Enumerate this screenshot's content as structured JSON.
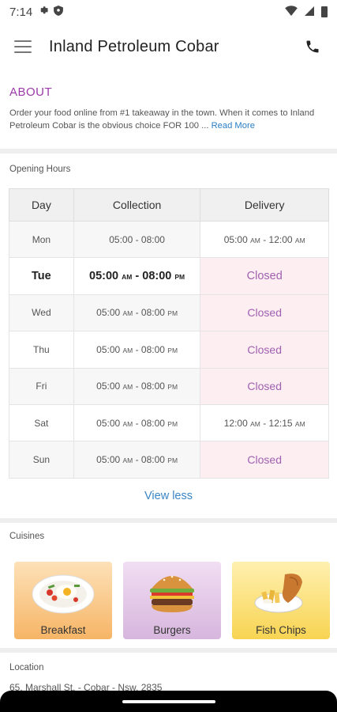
{
  "status_bar": {
    "time": "7:14",
    "icons": [
      "gear-icon",
      "shield-icon",
      "wifi-icon",
      "signal-icon",
      "battery-icon"
    ]
  },
  "app_bar": {
    "menu_icon": "hamburger-menu-icon",
    "title": "Inland Petroleum Cobar",
    "call_icon": "phone-icon"
  },
  "about": {
    "title": "ABOUT",
    "text": "Order your food online from #1 takeaway in the town. When it comes to Inland Petroleum Cobar is the obvious choice FOR 100 ...",
    "read_more": "Read More"
  },
  "opening_hours": {
    "label": "Opening Hours",
    "headers": {
      "day": "Day",
      "collection": "Collection",
      "delivery": "Delivery"
    },
    "rows": [
      {
        "day": "Mon",
        "collection": "05:00     - 08:00",
        "delivery": "05:00 AM - 12:00 AM",
        "delivery_closed": false,
        "today": false
      },
      {
        "day": "Tue",
        "collection": "05:00 AM - 08:00 PM",
        "delivery": "Closed",
        "delivery_closed": true,
        "today": true
      },
      {
        "day": "Wed",
        "collection": "05:00 AM - 08:00 PM",
        "delivery": "Closed",
        "delivery_closed": true,
        "today": false
      },
      {
        "day": "Thu",
        "collection": "05:00 AM - 08:00 PM",
        "delivery": "Closed",
        "delivery_closed": true,
        "today": false
      },
      {
        "day": "Fri",
        "collection": "05:00 AM - 08:00 PM",
        "delivery": "Closed",
        "delivery_closed": true,
        "today": false
      },
      {
        "day": "Sat",
        "collection": "05:00 AM - 08:00 PM",
        "delivery": "12:00 AM - 12:15 AM",
        "delivery_closed": false,
        "today": false
      },
      {
        "day": "Sun",
        "collection": "05:00 AM - 08:00 PM",
        "delivery": "Closed",
        "delivery_closed": true,
        "today": false
      }
    ],
    "view_less": "View less"
  },
  "cuisines": {
    "label": "Cuisines",
    "items": [
      {
        "name": "Breakfast",
        "icon": "breakfast-plate-icon"
      },
      {
        "name": "Burgers",
        "icon": "burger-icon"
      },
      {
        "name": "Fish  Chips",
        "icon": "fish-chips-icon"
      }
    ]
  },
  "location": {
    "label": "Location",
    "address": "65, Marshall St, - Cobar - Nsw, 2835"
  },
  "colors": {
    "accent": "#9b3aa8",
    "link": "#3a86c6",
    "closed_bg": "#fdeef2",
    "closed_text": "#a061b0"
  }
}
